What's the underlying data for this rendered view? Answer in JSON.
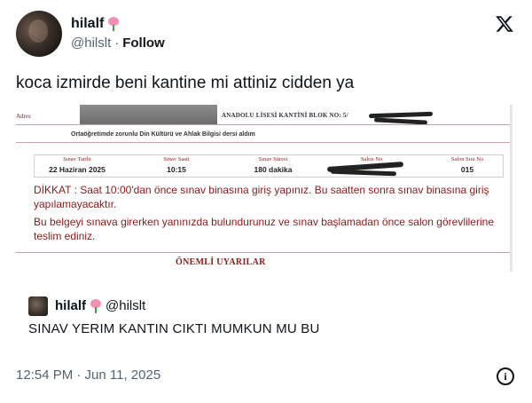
{
  "author": {
    "display_name": "hilalf",
    "handle": "@hilslt",
    "separator": "·",
    "follow_label": "Follow"
  },
  "tweet": {
    "text": "koca izmirde beni kantine mi attiniz cidden ya"
  },
  "document": {
    "adres_label": "Adres",
    "school_line": "ANADOLU LİSESİ KANTİNİ BLOK NO: 5/",
    "subject": "Ortaöğretimde zorunlu Din Kültürü ve Ahlak Bilgisi dersi aldım",
    "info": [
      {
        "label": "Sınav Tarihi",
        "value": "22 Haziran 2025"
      },
      {
        "label": "Sınav Saati",
        "value": "10:15"
      },
      {
        "label": "Sınav Süresi",
        "value": "180 dakika"
      },
      {
        "label": "Salon No",
        "value": ""
      },
      {
        "label": "Salon Sıra No",
        "value": "015"
      }
    ],
    "warning_p1": "DİKKAT : Saat 10:00'dan önce sınav binasına giriş yapınız. Bu saatten sonra sınav binasına giriş yapılamayacaktır.",
    "warning_p2": "Bu belgeyi sınava girerken yanınızda bulundurunuz ve sınav başlamadan önce salon görevlilerine teslim ediniz.",
    "section_title": "ÖNEMLİ UYARILAR"
  },
  "quoted": {
    "display_name": "hilalf",
    "handle": "@hilslt",
    "text": "SINAV YERIM KANTIN CIKTI MUMKUN MU BU"
  },
  "footer": {
    "timestamp": "12:54 PM · Jun 11, 2025",
    "info_glyph": "i"
  },
  "icons": {
    "brand": "x-logo-icon",
    "emoji": "tulip-icon",
    "info": "info-icon"
  }
}
